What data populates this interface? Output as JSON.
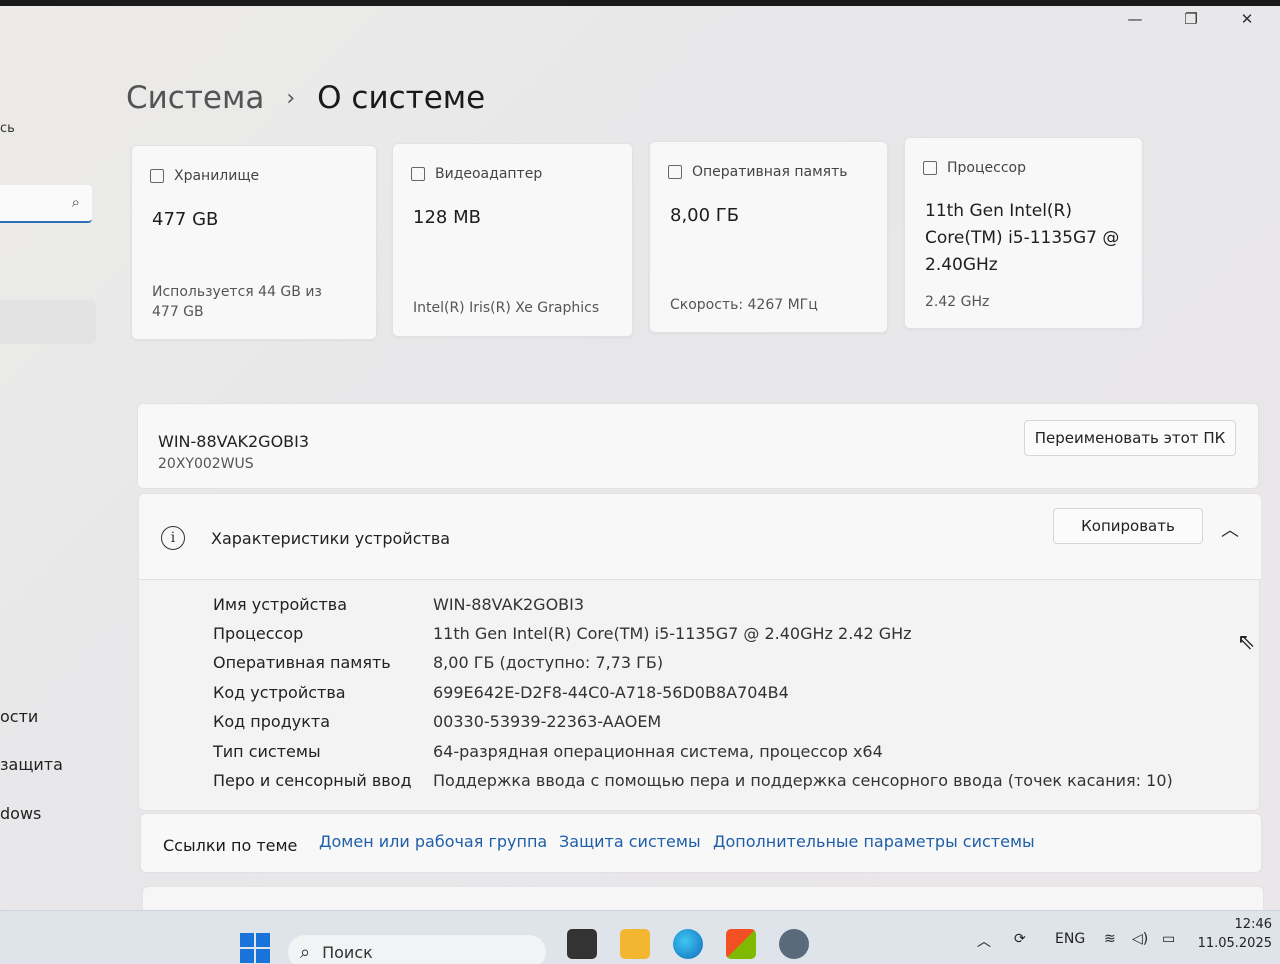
{
  "window": {
    "minimize": "—",
    "maximize": "❐",
    "close": "✕"
  },
  "sidebar": {
    "user_fragment": "сь",
    "search_icon": "search-icon",
    "items": [
      "ости",
      "защита",
      "dows"
    ]
  },
  "breadcrumb": {
    "parent": "Система",
    "separator": "›",
    "current": "О системе"
  },
  "cards": [
    {
      "icon": "storage-icon",
      "title": "Хранилище",
      "value": "477 GB",
      "sub": "Используется 44 GB из 477 GB"
    },
    {
      "icon": "display-icon",
      "title": "Видеоадаптер",
      "value": "128 MB",
      "sub": "Intel(R) Iris(R) Xe Graphics"
    },
    {
      "icon": "memory-icon",
      "title": "Оперативная память",
      "value": "8,00 ГБ",
      "sub": "Скорость: 4267 МГц"
    },
    {
      "icon": "processor-icon",
      "title": "Процессор",
      "value": "11th Gen Intel(R) Core(TM) i5-1135G7 @ 2.40GHz",
      "sub": "2.42 GHz"
    }
  ],
  "device": {
    "name": "WIN-88VAK2GOBI3",
    "model": "20XY002WUS",
    "rename_label": "Переименовать этот ПК"
  },
  "specs": {
    "title": "Характеристики устройства",
    "copy_label": "Копировать",
    "rows": [
      {
        "label": "Имя устройства",
        "value": "WIN-88VAK2GOBI3"
      },
      {
        "label": "Процессор",
        "value": "11th Gen Intel(R) Core(TM) i5-1135G7 @ 2.40GHz   2.42 GHz"
      },
      {
        "label": "Оперативная память",
        "value": "8,00 ГБ (доступно: 7,73 ГБ)"
      },
      {
        "label": "Код устройства",
        "value": "699E642E-D2F8-44C0-A718-56D0B8A704B4"
      },
      {
        "label": "Код продукта",
        "value": "00330-53939-22363-AAOEM"
      },
      {
        "label": "Тип системы",
        "value": "64-разрядная операционная система, процессор x64"
      },
      {
        "label": "Перо и сенсорный ввод",
        "value": "Поддержка ввода с помощью пера и поддержка сенсорного ввода (точек касания: 10)"
      }
    ]
  },
  "links": {
    "title": "Ссылки по теме",
    "items": [
      "Домен или рабочая группа",
      "Защита системы",
      "Дополнительные параметры системы"
    ]
  },
  "taskbar": {
    "search_placeholder": "Поиск",
    "language": "ENG",
    "time": "12:46",
    "date": "11.05.2025"
  },
  "colors": {
    "link": "#1f5fa8",
    "accent": "#2f6fb5"
  }
}
